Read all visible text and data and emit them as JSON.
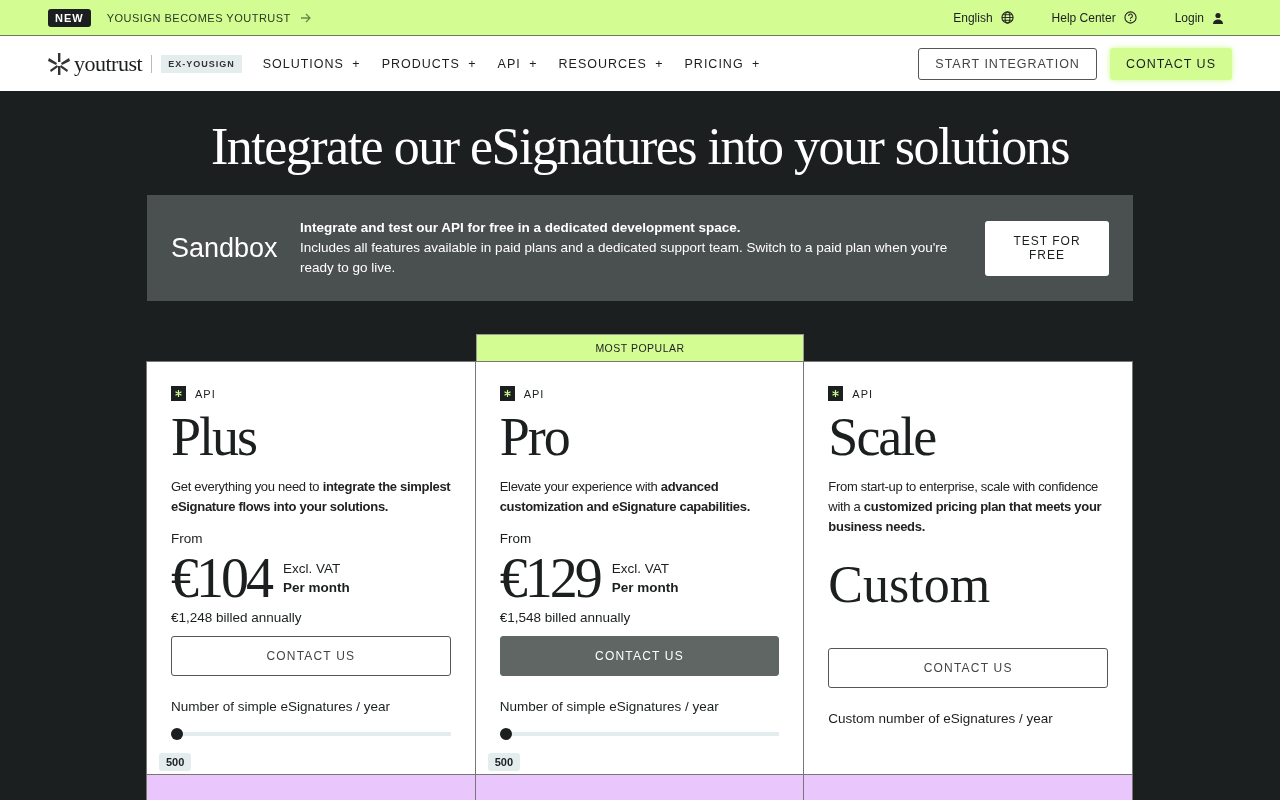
{
  "announcement": {
    "badge": "NEW",
    "text": "YOUSIGN BECOMES YOUTRUST",
    "links": [
      {
        "label": "English"
      },
      {
        "label": "Help Center"
      },
      {
        "label": "Login"
      }
    ]
  },
  "nav": {
    "logo": "youtrust",
    "tag": "EX-YOUSIGN",
    "items": [
      "SOLUTIONS",
      "PRODUCTS",
      "API",
      "RESOURCES",
      "PRICING"
    ],
    "expand_mark": "+",
    "buttons": [
      {
        "label": "START INTEGRATION",
        "kind": "outline"
      },
      {
        "label": "CONTACT US",
        "kind": "accent"
      }
    ]
  },
  "hero": {
    "title": "Integrate our eSignatures into your solutions"
  },
  "sandbox": {
    "title": "Sandbox",
    "lead": "Integrate and test our API for free in a dedicated development space.",
    "text": "Includes all features available in paid plans and a dedicated support team. Switch to a paid plan when you're ready to go live.",
    "button": "TEST FOR FREE"
  },
  "plans": [
    {
      "kind": "price",
      "popular": false,
      "category": "API",
      "name": "Plus",
      "description": "Get everything you need to **integrate the simplest eSignature flows into your solutions.**",
      "from": "From",
      "price": "€104",
      "tax": "Excl. VAT",
      "period": "Per month",
      "billed": "€1,248  billed annually",
      "button": "CONTACT US",
      "quota_label": "Number of simple eSignatures / year",
      "slider": {
        "level": 0,
        "value": "500"
      }
    },
    {
      "kind": "price",
      "popular": true,
      "ribbon": "MOST POPULAR",
      "category": "API",
      "name": "Pro",
      "description": "Elevate your experience with **advanced customization and eSignature capabilities.**",
      "from": "From",
      "price": "€129",
      "tax": "Excl. VAT",
      "period": "Per month",
      "billed": "€1,548  billed annually",
      "button": "CONTACT US",
      "quota_label": "Number of simple eSignatures / year",
      "slider": {
        "level": 0,
        "value": "500"
      }
    },
    {
      "kind": "custom",
      "popular": false,
      "category": "API",
      "name": "Scale",
      "description": "From start-up to enterprise, scale with confidence with a **customized pricing plan that meets your business needs.**",
      "price": "Custom",
      "button": "CONTACT US",
      "quota_label": "Custom number of eSignatures / year"
    }
  ]
}
